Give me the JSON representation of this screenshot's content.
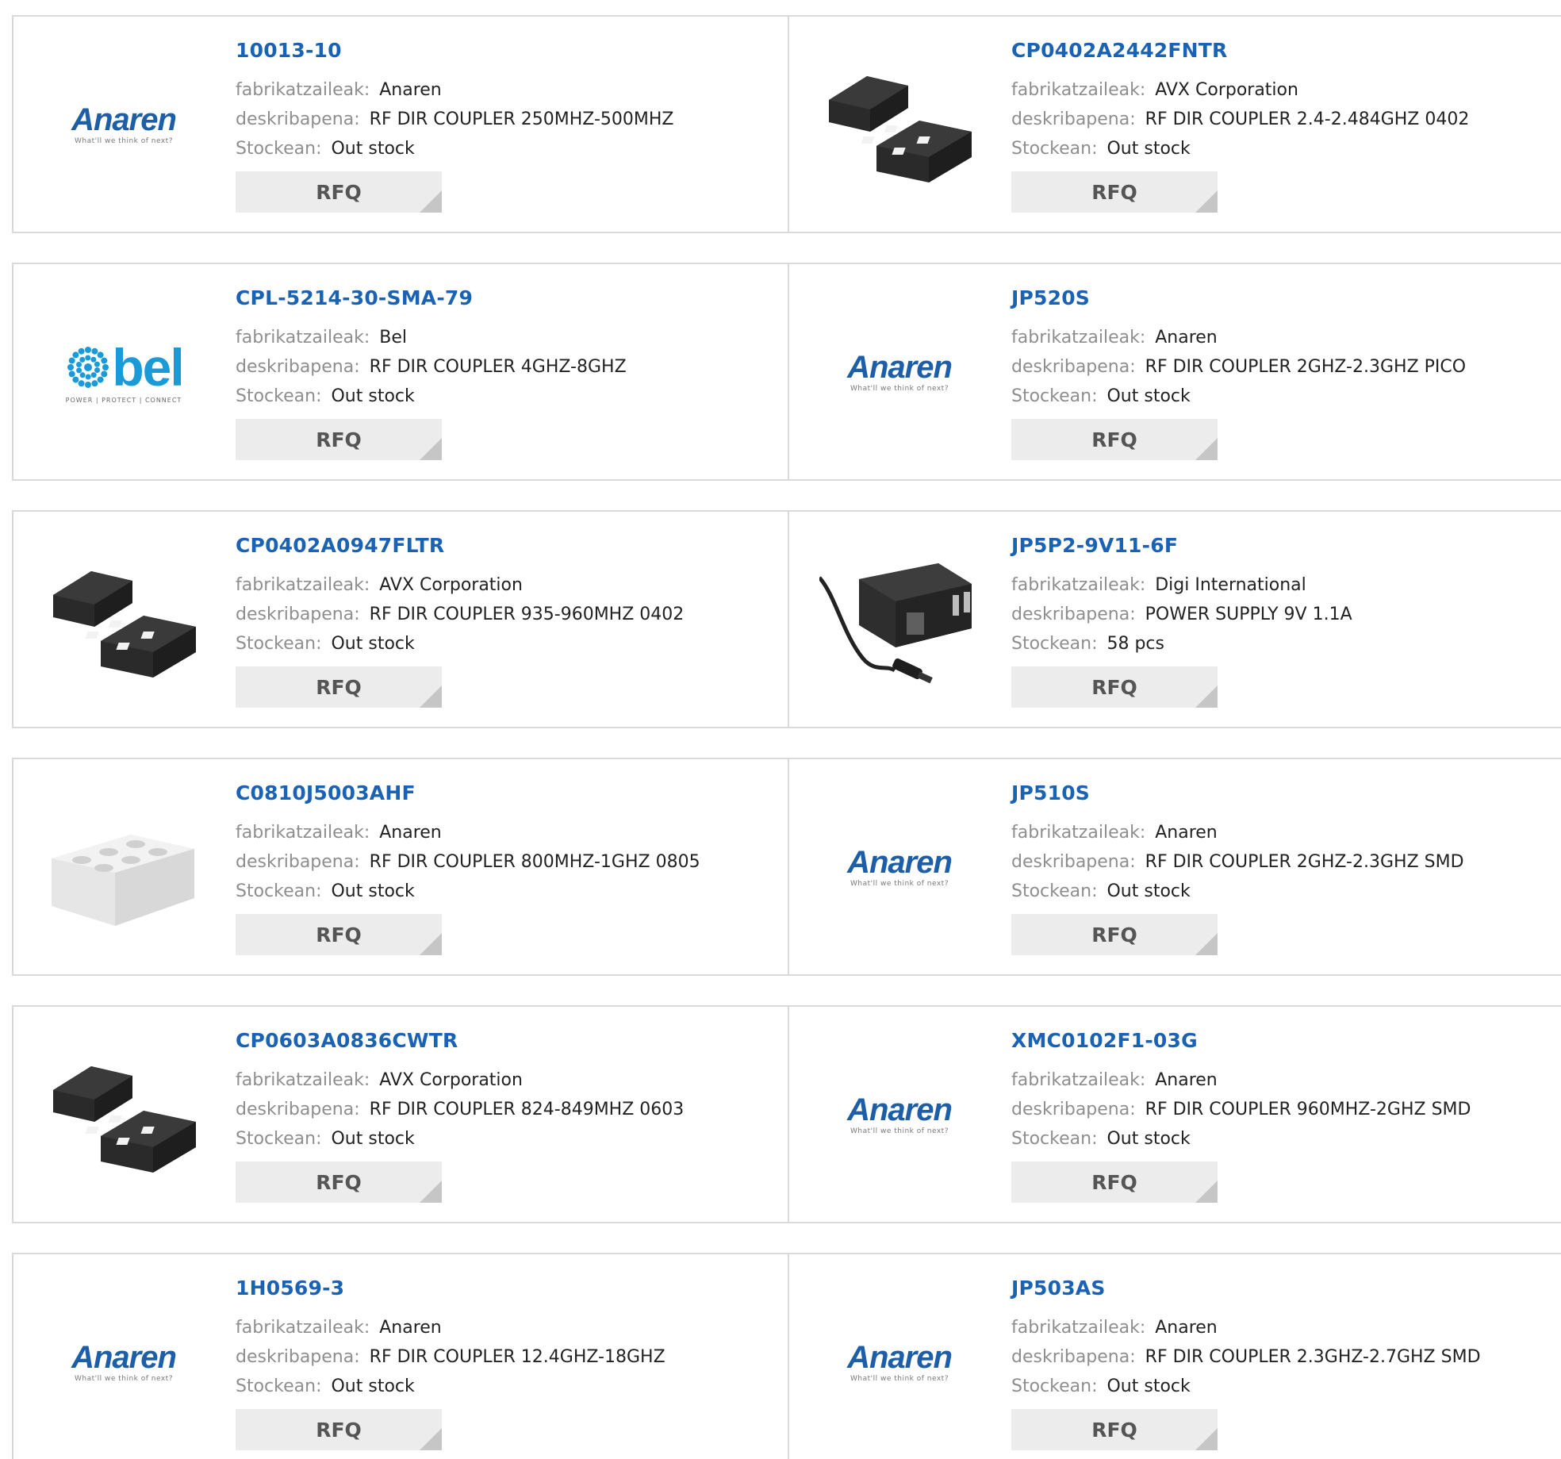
{
  "labels": {
    "manufacturer": "fabrikatzaileak:",
    "description": "deskribapena:",
    "stock": "Stockean:",
    "rfq": "RFQ"
  },
  "products": [
    {
      "part": "10013-10",
      "manufacturer": "Anaren",
      "description": "RF DIR COUPLER 250MHZ-500MHZ",
      "stock": "Out stock",
      "image": "anaren-logo"
    },
    {
      "part": "CP0402A2442FNTR",
      "manufacturer": "AVX Corporation",
      "description": "RF DIR COUPLER 2.4-2.484GHZ 0402",
      "stock": "Out stock",
      "image": "dark-chip"
    },
    {
      "part": "CPL-5214-30-SMA-79",
      "manufacturer": "Bel",
      "description": "RF DIR COUPLER 4GHZ-8GHZ",
      "stock": "Out stock",
      "image": "bel-logo"
    },
    {
      "part": "JP520S",
      "manufacturer": "Anaren",
      "description": "RF DIR COUPLER 2GHZ-2.3GHZ PICO",
      "stock": "Out stock",
      "image": "anaren-logo"
    },
    {
      "part": "CP0402A0947FLTR",
      "manufacturer": "AVX Corporation",
      "description": "RF DIR COUPLER 935-960MHZ 0402",
      "stock": "Out stock",
      "image": "dark-chip"
    },
    {
      "part": "JP5P2-9V11-6F",
      "manufacturer": "Digi International",
      "description": "POWER SUPPLY 9V 1.1A",
      "stock": "58 pcs",
      "image": "power-adapter"
    },
    {
      "part": "C0810J5003AHF",
      "manufacturer": "Anaren",
      "description": "RF DIR COUPLER 800MHZ-1GHZ 0805",
      "stock": "Out stock",
      "image": "white-chip"
    },
    {
      "part": "JP510S",
      "manufacturer": "Anaren",
      "description": "RF DIR COUPLER 2GHZ-2.3GHZ SMD",
      "stock": "Out stock",
      "image": "anaren-logo"
    },
    {
      "part": "CP0603A0836CWTR",
      "manufacturer": "AVX Corporation",
      "description": "RF DIR COUPLER 824-849MHZ 0603",
      "stock": "Out stock",
      "image": "dark-chip"
    },
    {
      "part": "XMC0102F1-03G",
      "manufacturer": "Anaren",
      "description": "RF DIR COUPLER 960MHZ-2GHZ SMD",
      "stock": "Out stock",
      "image": "anaren-logo"
    },
    {
      "part": "1H0569-3",
      "manufacturer": "Anaren",
      "description": "RF DIR COUPLER 12.4GHZ-18GHZ",
      "stock": "Out stock",
      "image": "anaren-logo"
    },
    {
      "part": "JP503AS",
      "manufacturer": "Anaren",
      "description": "RF DIR COUPLER 2.3GHZ-2.7GHZ SMD",
      "stock": "Out stock",
      "image": "anaren-logo"
    }
  ],
  "logos": {
    "anaren_word": "Anaren",
    "anaren_tag": "What'll we think of next?",
    "bel_word": "bel",
    "bel_tag": "POWER | PROTECT | CONNECT"
  },
  "colors": {
    "link": "#1a62b4",
    "anaren": "#1d5ea8",
    "bel": "#1a9ad6"
  }
}
